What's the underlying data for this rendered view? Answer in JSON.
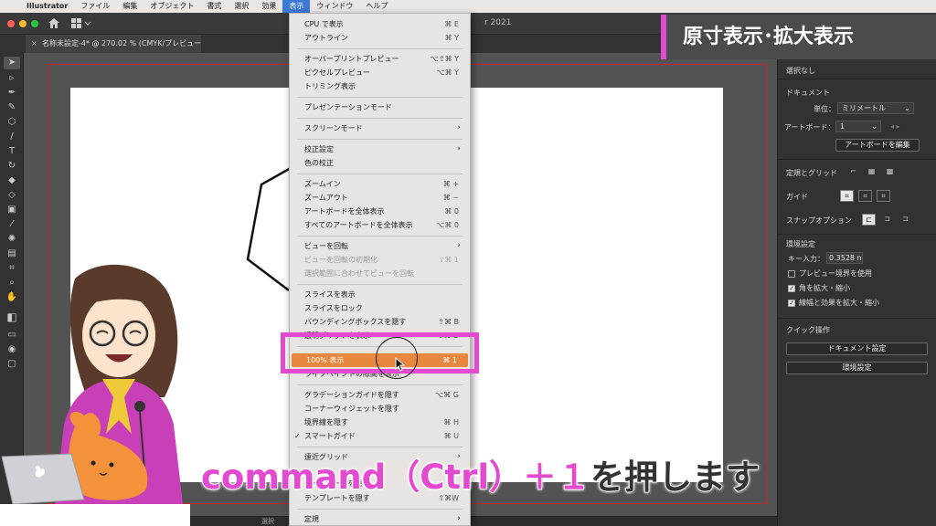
{
  "menubar": {
    "app": "Illustrator",
    "items": [
      "ファイル",
      "編集",
      "オブジェクト",
      "書式",
      "選択",
      "効果",
      "表示",
      "ウィンドウ",
      "ヘルプ"
    ]
  },
  "appbar": {
    "title_fragment": "r 2021"
  },
  "document_tab": {
    "close": "×",
    "title": "名称未設定-4* @ 270.02 % (CMYK/プレビュー)"
  },
  "view_menu": {
    "items": [
      {
        "label": "CPU で表示",
        "shortcut": "⌘ E"
      },
      {
        "label": "アウトライン",
        "shortcut": "⌘ Y"
      },
      {
        "label": "オーバープリントプレビュー",
        "shortcut": "⌥⇧⌘ Y"
      },
      {
        "label": "ピクセルプレビュー",
        "shortcut": "⌥⌘ Y"
      },
      {
        "label": "トリミング表示",
        "shortcut": ""
      },
      {
        "label": "プレゼンテーションモード",
        "shortcut": ""
      },
      {
        "label": "スクリーンモード",
        "shortcut": ""
      },
      {
        "label": "校正設定",
        "shortcut": ""
      },
      {
        "label": "色の校正",
        "shortcut": ""
      },
      {
        "label": "ズームイン",
        "shortcut": "⌘ +"
      },
      {
        "label": "ズームアウト",
        "shortcut": "⌘ −"
      },
      {
        "label": "アートボードを全体表示",
        "shortcut": "⌘ 0"
      },
      {
        "label": "すべてのアートボードを全体表示",
        "shortcut": "⌥⌘ 0"
      },
      {
        "label": "ビューを回転",
        "shortcut": ""
      },
      {
        "label": "ビューを回転の初期化",
        "shortcut": "⇧⌘ 1"
      },
      {
        "label": "選択範囲に合わせてビューを回転",
        "shortcut": ""
      },
      {
        "label": "スライスを表示",
        "shortcut": ""
      },
      {
        "label": "スライスをロック",
        "shortcut": ""
      },
      {
        "label": "バウンディングボックスを隠す",
        "shortcut": "⇧⌘ B"
      },
      {
        "label": "透明グリッドを表示",
        "shortcut": "⇧⌘ D"
      },
      {
        "label": "100% 表示",
        "shortcut": "⌘ 1"
      },
      {
        "label": "ライブペイントの隙間を表示",
        "shortcut": ""
      },
      {
        "label": "グラデーションガイドを隠す",
        "shortcut": "⌥⌘ G"
      },
      {
        "label": "コーナーウィジェットを隠す",
        "shortcut": ""
      },
      {
        "label": "境界線を隠す",
        "shortcut": "⌘ H"
      },
      {
        "label": "スマートガイド",
        "shortcut": "⌘ U"
      },
      {
        "label": "遠近グリッド",
        "shortcut": ""
      },
      {
        "label": "アートボードを隠す",
        "shortcut": ""
      },
      {
        "label": "テンプレートを隠す",
        "shortcut": "⇧⌘W"
      },
      {
        "label": "定規",
        "shortcut": ""
      }
    ]
  },
  "right_panel": {
    "no_selection": "選択なし",
    "document_header": "ドキュメント",
    "units_label": "単位：",
    "units_value": "ミリメートル",
    "artboard_label": "アートボード：",
    "artboard_value": "1",
    "edit_artboard_button": "アートボードを編集",
    "rulers_grids": "定規とグリッド",
    "guides": "ガイド",
    "snap_options": "スナップオプション",
    "preferences_header": "環境設定",
    "key_increment_label": "キー入力：",
    "key_increment_value": "0.3528 n",
    "preview_bounds": "プレビュー境界を使用",
    "scale_corners": "角を拡大・縮小",
    "scale_strokes": "線幅と効果を拡大・縮小",
    "quick_actions": "クイック操作",
    "document_setup_button": "ドキュメント設定",
    "preferences_button": "環境設定"
  },
  "overlay": {
    "title_banner": "原寸表示･拡大表示",
    "caption_highlight": "command（Ctrl）＋１",
    "caption_rest": "を押します"
  },
  "statusbar": {
    "text": "選択"
  },
  "colors": {
    "highlight_pink": "#e34ad0",
    "menu_highlight": "#e9873e",
    "artboard_border": "#c0262b"
  }
}
